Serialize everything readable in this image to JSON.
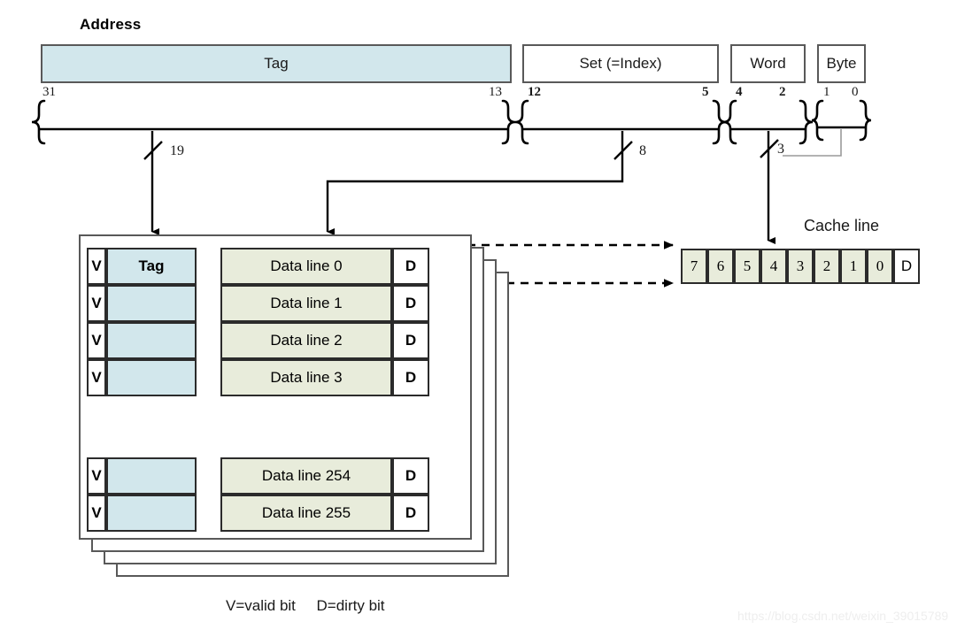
{
  "diagram": {
    "title": "Address",
    "legend": "V=valid bit     D=dirty bit",
    "cache_line_label": "Cache line",
    "watermark": "https://blog.csdn.net/weixin_39015789",
    "colors": {
      "tag_fill": "#d2e7ec",
      "data_fill": "#e8ecdb",
      "box_stroke": "#595959",
      "cell_stroke": "#2b2b2b",
      "text": "#1a1a1a"
    }
  },
  "address_fields": [
    {
      "label": "Tag",
      "msb": "31",
      "lsb": "13",
      "width": "19",
      "filled": true,
      "bold_bits": false
    },
    {
      "label": "Set (=Index)",
      "msb": "12",
      "lsb": "5",
      "width": "8",
      "filled": false,
      "bold_bits": true
    },
    {
      "label": "Word",
      "msb": "4",
      "lsb": "2",
      "width": "3",
      "filled": false,
      "bold_bits": true
    },
    {
      "label": "Byte",
      "msb": "1",
      "lsb": "0",
      "width": "",
      "filled": false,
      "bold_bits": false
    }
  ],
  "cache_table": {
    "valid_label": "V",
    "dirty_label": "D",
    "tag_header": "Tag",
    "rows": [
      {
        "valid": "V",
        "tag": "Tag",
        "data": "Data line 0",
        "dirty": "D"
      },
      {
        "valid": "V",
        "tag": "",
        "data": "Data line 1",
        "dirty": "D"
      },
      {
        "valid": "V",
        "tag": "",
        "data": "Data line 2",
        "dirty": "D"
      },
      {
        "valid": "V",
        "tag": "",
        "data": "Data line 3",
        "dirty": "D"
      }
    ],
    "rows_bottom": [
      {
        "valid": "V",
        "tag": "",
        "data": "Data line 254",
        "dirty": "D"
      },
      {
        "valid": "V",
        "tag": "",
        "data": "Data line 255",
        "dirty": "D"
      }
    ],
    "ellipsis": "vertical-dotted",
    "stack_layers": 4
  },
  "cache_line": {
    "bytes": [
      "7",
      "6",
      "5",
      "4",
      "3",
      "2",
      "1",
      "0"
    ],
    "dirty": "D"
  }
}
